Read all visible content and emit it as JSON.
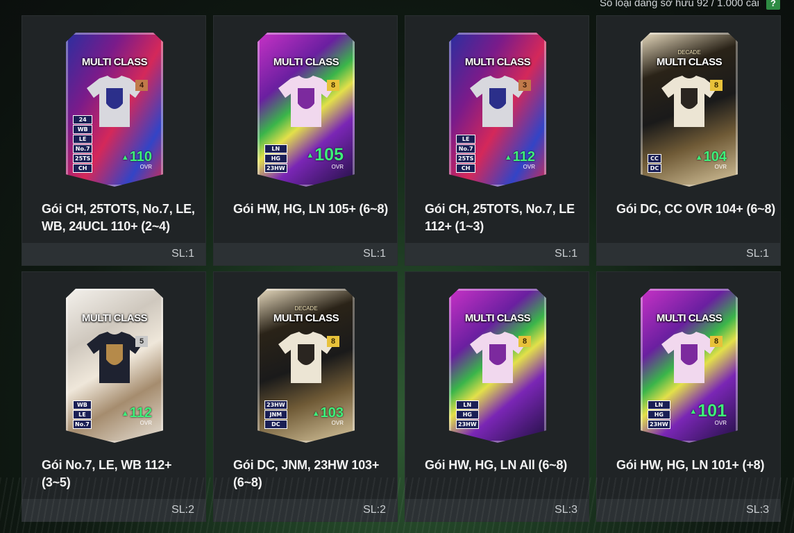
{
  "header": {
    "inventory_text": "Số loại đang sở hữu  92 / 1.000 cái",
    "help_label": "?"
  },
  "colors": {
    "ovr_green": "#3ef07a",
    "tile_bg": "#202426",
    "footer_bg": "#2c3134"
  },
  "packs": [
    {
      "name": "Gói CH, 25TOTS, No.7, LE, WB, 24UCL 110+ (2~4)",
      "quantity": "SL:1",
      "card_title": "MULTI CLASS",
      "card_subtitle": "",
      "grade": "4",
      "ovr_value": "110",
      "ovr_label": "OVR",
      "badges": [
        "24",
        "WB",
        "LE",
        "No.7",
        "25TS",
        "CH"
      ],
      "theme": "red",
      "crest_icon": "v-logo-icon"
    },
    {
      "name": "Gói HW, HG, LN 105+ (6~8)",
      "quantity": "SL:1",
      "card_title": "MULTI CLASS",
      "card_subtitle": "",
      "grade": "8",
      "ovr_value": "105",
      "ovr_label": "OVR",
      "badges": [
        "LN",
        "HG",
        "23HW"
      ],
      "theme": "purple",
      "crest_icon": "hw-crest-icon"
    },
    {
      "name": "Gói CH, 25TOTS, No.7, LE 112+ (1~3)",
      "quantity": "SL:1",
      "card_title": "MULTI CLASS",
      "card_subtitle": "",
      "grade": "3",
      "ovr_value": "112",
      "ovr_label": "OVR",
      "badges": [
        "LE",
        "No.7",
        "25TS",
        "CH"
      ],
      "theme": "red",
      "crest_icon": "v-logo-icon"
    },
    {
      "name": "Gói DC, CC OVR 104+ (6~8)",
      "quantity": "SL:1",
      "card_title": "MULTI CLASS",
      "card_subtitle": "DECADE",
      "grade": "8",
      "ovr_value": "104",
      "ovr_label": "OVR",
      "badges": [
        "CC",
        "DC"
      ],
      "theme": "gold",
      "crest_icon": "dc-crest-icon"
    },
    {
      "name": "Gói No.7, LE, WB 112+ (3~5)",
      "quantity": "SL:2",
      "card_title": "MULTI CLASS",
      "card_subtitle": "",
      "grade": "5",
      "ovr_value": "112",
      "ovr_label": "OVR",
      "badges": [
        "WB",
        "LE",
        "No.7"
      ],
      "theme": "silver",
      "crest_icon": "seven-crest-icon"
    },
    {
      "name": "Gói DC, JNM, 23HW 103+ (6~8)",
      "quantity": "SL:2",
      "card_title": "MULTI CLASS",
      "card_subtitle": "DECADE",
      "grade": "8",
      "ovr_value": "103",
      "ovr_label": "OVR",
      "badges": [
        "23HW",
        "JNM",
        "DC"
      ],
      "theme": "gold",
      "crest_icon": "dc-crest-icon"
    },
    {
      "name": "Gói HW, HG, LN All (6~8)",
      "quantity": "SL:3",
      "card_title": "MULTI CLASS",
      "card_subtitle": "",
      "grade": "8",
      "ovr_value": "",
      "ovr_label": "",
      "badges": [
        "LN",
        "HG",
        "23HW"
      ],
      "theme": "purple",
      "crest_icon": "hw-crest-icon"
    },
    {
      "name": "Gói HW, HG, LN 101+ (+8)",
      "quantity": "SL:3",
      "card_title": "MULTI CLASS",
      "card_subtitle": "",
      "grade": "8",
      "ovr_value": "101",
      "ovr_label": "OVR",
      "badges": [
        "LN",
        "HG",
        "23HW"
      ],
      "theme": "purple",
      "crest_icon": "hw-crest-icon"
    }
  ]
}
